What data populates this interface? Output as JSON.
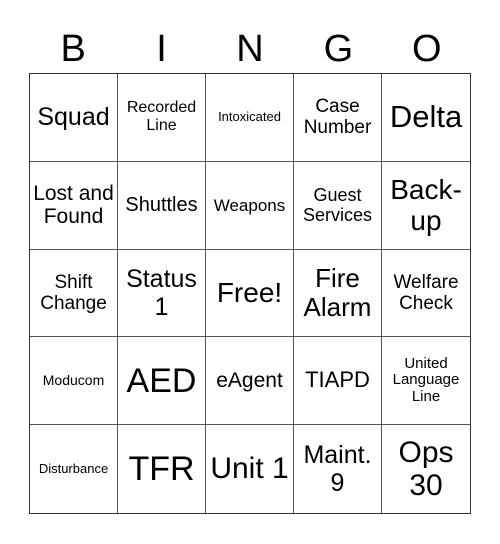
{
  "title_letters": [
    "B",
    "I",
    "N",
    "G",
    "O"
  ],
  "cells": [
    {
      "text": "Squad",
      "size": 25
    },
    {
      "text": "Recorded Line",
      "size": 16
    },
    {
      "text": "Intoxicated",
      "size": 13
    },
    {
      "text": "Case Number",
      "size": 19
    },
    {
      "text": "Delta",
      "size": 31
    },
    {
      "text": "Lost and Found",
      "size": 21
    },
    {
      "text": "Shuttles",
      "size": 20
    },
    {
      "text": "Weapons",
      "size": 17
    },
    {
      "text": "Guest Services",
      "size": 18
    },
    {
      "text": "Back-up",
      "size": 28
    },
    {
      "text": "Shift Change",
      "size": 19
    },
    {
      "text": "Status 1",
      "size": 25
    },
    {
      "text": "Free!",
      "size": 28
    },
    {
      "text": "Fire Alarm",
      "size": 26
    },
    {
      "text": "Welfare Check",
      "size": 19
    },
    {
      "text": "Moducom",
      "size": 14
    },
    {
      "text": "AED",
      "size": 34
    },
    {
      "text": "eAgent",
      "size": 21
    },
    {
      "text": "TIAPD",
      "size": 22
    },
    {
      "text": "United Language Line",
      "size": 15
    },
    {
      "text": "Disturbance",
      "size": 13
    },
    {
      "text": "TFR",
      "size": 34
    },
    {
      "text": "Unit 1",
      "size": 30
    },
    {
      "text": "Maint. 9",
      "size": 25
    },
    {
      "text": "Ops 30",
      "size": 30
    }
  ]
}
